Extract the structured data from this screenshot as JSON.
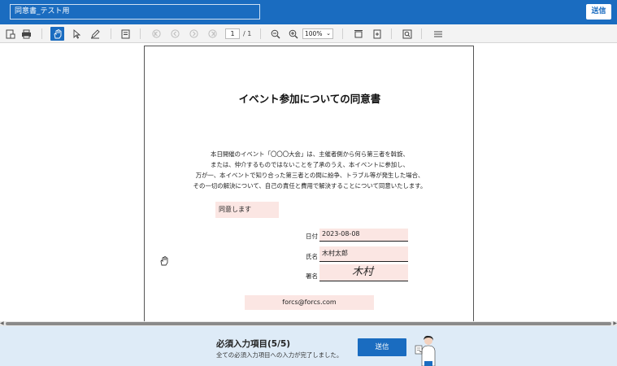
{
  "header": {
    "document_title": "同意書_テスト用",
    "send_label": "送信"
  },
  "toolbar": {
    "page_current": "1",
    "page_total": "/ 1",
    "zoom": "100%",
    "icons": [
      "save-icon",
      "print-icon",
      "hand-tool-icon",
      "select-tool-icon",
      "pen-icon",
      "page-view-icon",
      "first-page-icon",
      "prev-page-icon",
      "next-page-icon",
      "last-page-icon",
      "zoom-out-icon",
      "zoom-in-icon",
      "fit-page-icon",
      "fit-width-icon",
      "search-icon",
      "menu-icon"
    ]
  },
  "document": {
    "title": "イベント参加についての同意書",
    "body": [
      "本日開催のイベント「〇〇〇大会」は、主催者側から何ら第三者を斡旋、",
      "または、仲介するものではないことを了承のうえ、本イベントに参加し、",
      "万が一、本イベントで知り合った第三者との間に紛争、トラブル等が発生した場合、",
      "その一切の解決について、自己の責任と費用で解決することについて同意いたします。"
    ],
    "agree_field": "同意します",
    "date_label": "日付",
    "date_value": "2023-08-08",
    "name_label": "氏名",
    "name_value": "木村太郎",
    "signature_label": "署名",
    "signature_value": "木村",
    "email_value": "forcs@forcs.com"
  },
  "footer": {
    "required_title": "必須入力項目(5/5)",
    "required_sub": "全ての必須入力項目への入力が完了しました。",
    "send_label": "送信"
  },
  "colors": {
    "brand": "#1a6cc0",
    "field_fill": "#fbe6e3",
    "footer_bg": "#deebf7"
  }
}
